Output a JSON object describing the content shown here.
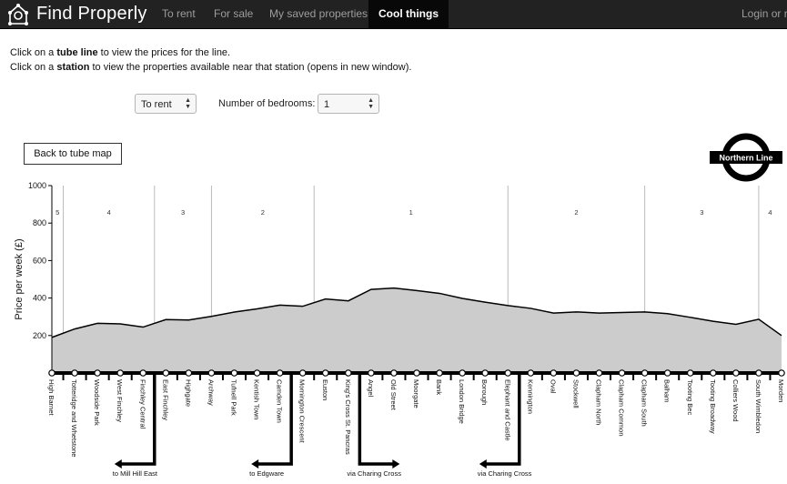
{
  "navbar": {
    "brand": "Find Properly",
    "items": [
      {
        "label": "To rent",
        "active": false
      },
      {
        "label": "For sale",
        "active": false
      },
      {
        "label": "My saved properties",
        "active": false
      },
      {
        "label": "Cool things",
        "active": true
      }
    ],
    "login_label": "Login or r"
  },
  "instructions": {
    "line1_pre": "Click on a ",
    "line1_bold": "tube line",
    "line1_post": " to view the prices for the line.",
    "line2_pre": "Click on a ",
    "line2_bold": "station",
    "line2_post": " to view the properties available near that station (opens in new window)."
  },
  "controls": {
    "mode_value": "To rent",
    "bedrooms_label": "Number of bedrooms:",
    "bedrooms_value": "1"
  },
  "back_button_label": "Back to tube map",
  "roundel_label": "Northern Line",
  "chart_data": {
    "type": "area",
    "ylabel": "Price per week (£)",
    "ylim": [
      0,
      1000
    ],
    "yticks": [
      200,
      400,
      600,
      800,
      1000
    ],
    "stations": [
      "High Barnet",
      "Totteridge and Whetstone",
      "Woodside Park",
      "West Finchley",
      "Finchley Central",
      "East Finchley",
      "Highgate",
      "Archway",
      "Tufnell Park",
      "Kentish Town",
      "Camden Town",
      "Mornington Crescent",
      "Euston",
      "King's Cross St. Pancras",
      "Angel",
      "Old Street",
      "Moorgate",
      "Bank",
      "London Bridge",
      "Borough",
      "Elephant and Castle",
      "Kennington",
      "Oval",
      "Stockwell",
      "Clapham North",
      "Clapham Common",
      "Clapham South",
      "Balham",
      "Tooting Bec",
      "Tooting Broadway",
      "Colliers Wood",
      "South Wimbledon",
      "Morden"
    ],
    "values": [
      190,
      235,
      265,
      262,
      245,
      285,
      283,
      302,
      325,
      342,
      362,
      356,
      395,
      385,
      446,
      453,
      440,
      425,
      398,
      378,
      360,
      345,
      320,
      326,
      320,
      323,
      326,
      317,
      297,
      276,
      260,
      287,
      200
    ],
    "zones": [
      {
        "label": "5",
        "from_station": -0.5,
        "to_station": 0.5
      },
      {
        "label": "4",
        "from_station": 0.5,
        "to_station": 4.5
      },
      {
        "label": "3",
        "from_station": 4.5,
        "to_station": 7.0
      },
      {
        "label": "2",
        "from_station": 7.0,
        "to_station": 11.5
      },
      {
        "label": "1",
        "from_station": 11.5,
        "to_station": 20.0
      },
      {
        "label": "2",
        "from_station": 20.0,
        "to_station": 26.0
      },
      {
        "label": "3",
        "from_station": 26.0,
        "to_station": 31.0
      },
      {
        "label": "4",
        "from_station": 31.0,
        "to_station": 32.5
      }
    ],
    "branches": [
      {
        "label": "to Mill Hill East",
        "from_station": 4,
        "direction": "left"
      },
      {
        "label": "to Edgware",
        "from_station": 10,
        "direction": "left"
      },
      {
        "label": "via Charing Cross",
        "from_station": 13,
        "direction": "right"
      },
      {
        "label": "via Charing Cross",
        "from_station": 20,
        "direction": "left"
      }
    ],
    "colors": {
      "area": "#cccccc",
      "line": "#000000",
      "zone_divider": "#bbbbbb"
    }
  }
}
